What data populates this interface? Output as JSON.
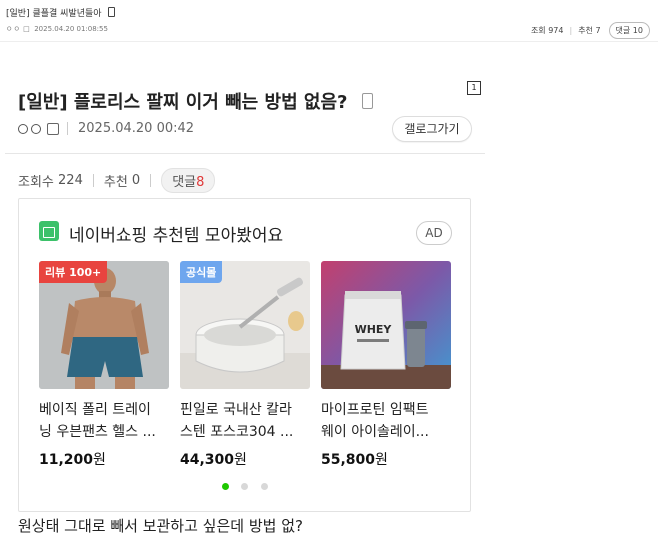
{
  "outer_post": {
    "title": "[일반] 클플결 씨발년들아",
    "meta": "ㅇㅇ",
    "datetime": "2025.04.20 01:08:55",
    "views_label": "조회 974",
    "recommend_label": "추천 7",
    "comments_label": "댓글 10"
  },
  "inner_post": {
    "page_badge": "1",
    "title": "[일반] 플로리스 팔찌 이거 빼는 방법 없음?",
    "author": "ㅇㅇ",
    "datetime": "2025.04.20 00:42",
    "gallery_button": "갤로그가기",
    "views_label": "조회수",
    "views_value": "224",
    "recommend_label": "추천",
    "recommend_value": "0",
    "comments_label": "댓글",
    "comments_value": "8",
    "body_text": "원상태 그대로 빼서 보관하고 싶은데 방법 없?"
  },
  "ad": {
    "title": "네이버쇼핑 추천템 모아봤어요",
    "badge": "AD",
    "logo_color": "#3cc16a",
    "products": [
      {
        "tag": "리뷰 100+",
        "tag_color": "#e8443f",
        "name_line1": "베이직 폴리 트레이",
        "name_line2": "닝 우븐팬츠 헬스 ...",
        "price": "11,200",
        "currency": "원"
      },
      {
        "tag": "공식몰",
        "tag_color": "#6ea6ee",
        "name_line1": "핀일로 국내산 칼라",
        "name_line2": "스텐 포스코304 ...",
        "price": "44,300",
        "currency": "원"
      },
      {
        "tag": "",
        "tag_color": "",
        "name_line1": "마이프로틴 임팩트",
        "name_line2": "웨이 아이솔레이...",
        "price": "55,800",
        "currency": "원"
      }
    ],
    "product_label_text": "WHEY",
    "carousel": {
      "count": 3,
      "active_index": 0,
      "active_color": "#1ec800"
    }
  }
}
